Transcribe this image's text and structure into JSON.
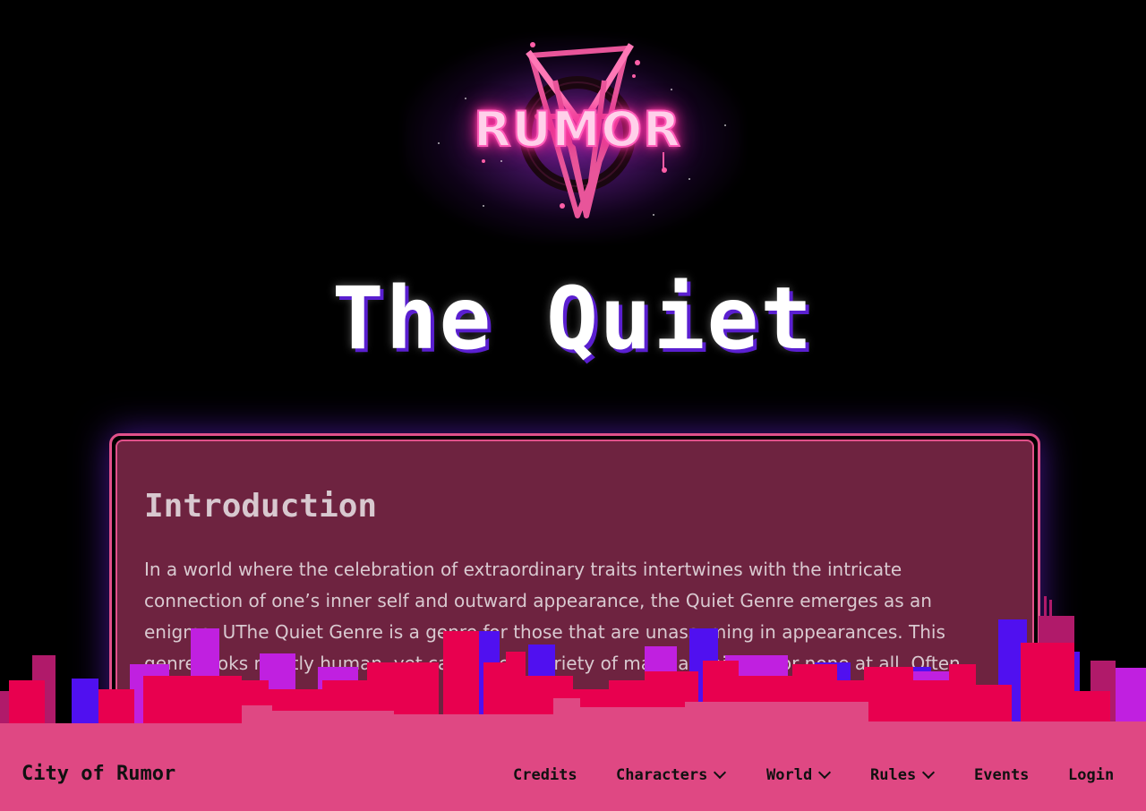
{
  "logo": {
    "text": "RUMOR",
    "icon": "pentagram-icon"
  },
  "page": {
    "title": "The Quiet"
  },
  "card": {
    "heading": "Introduction",
    "body": "In a world where the celebration of extraordinary traits intertwines with the intricate connection of one’s inner self and outward appearance, the Quiet Genre emerges as an enigma. UThe Quiet Genre is a genre for those that are unassuming in appearances. This genre looks mostly human, yet can have a variety of magical abilities, or none at all. Often the echoes"
  },
  "navbar": {
    "brand": "City of Rumor",
    "items": {
      "credits": "Credits",
      "characters": "Characters",
      "world": "World",
      "rules": "Rules",
      "events": "Events",
      "login": "Login"
    }
  },
  "colors": {
    "background": "#000000",
    "accent_pink": "#df4883",
    "card_fill": "#6e2340",
    "card_border": "#e0508a",
    "title_shadow": "#5a1fd0",
    "skyline_red": "#e8004f",
    "skyline_purple": "#c020e0",
    "skyline_blue": "#5010f0"
  }
}
